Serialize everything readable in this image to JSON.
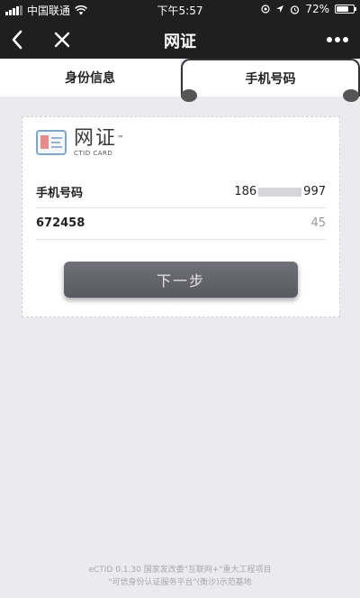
{
  "status_bar": {
    "carrier": "中国联通",
    "time": "下午5:57",
    "battery": "72%",
    "battery_level": 0.72
  },
  "nav": {
    "title": "网证"
  },
  "tabs": [
    {
      "label": "身份信息",
      "active": false
    },
    {
      "label": "手机号码",
      "active": true
    }
  ],
  "card": {
    "logo_title": "网证",
    "logo_tm": "™",
    "logo_subtitle": "CTID CARD",
    "phone_label": "手机号码",
    "phone_prefix": "186",
    "phone_suffix": "997",
    "code_value": "672458",
    "countdown": "45",
    "next_button_label": "下一步"
  },
  "footer": {
    "line1": "eCTID 0.1.30 国家发改委\"互联网+\"重大工程项目",
    "line2": "\"可信身份认证服务平台\"(衡沙)示范基地"
  },
  "icons": {
    "back": "chevron-left-icon",
    "close": "close-icon",
    "more": "more-icon",
    "wifi": "wifi-icon",
    "location": "location-icon",
    "alarm": "alarm-icon"
  }
}
